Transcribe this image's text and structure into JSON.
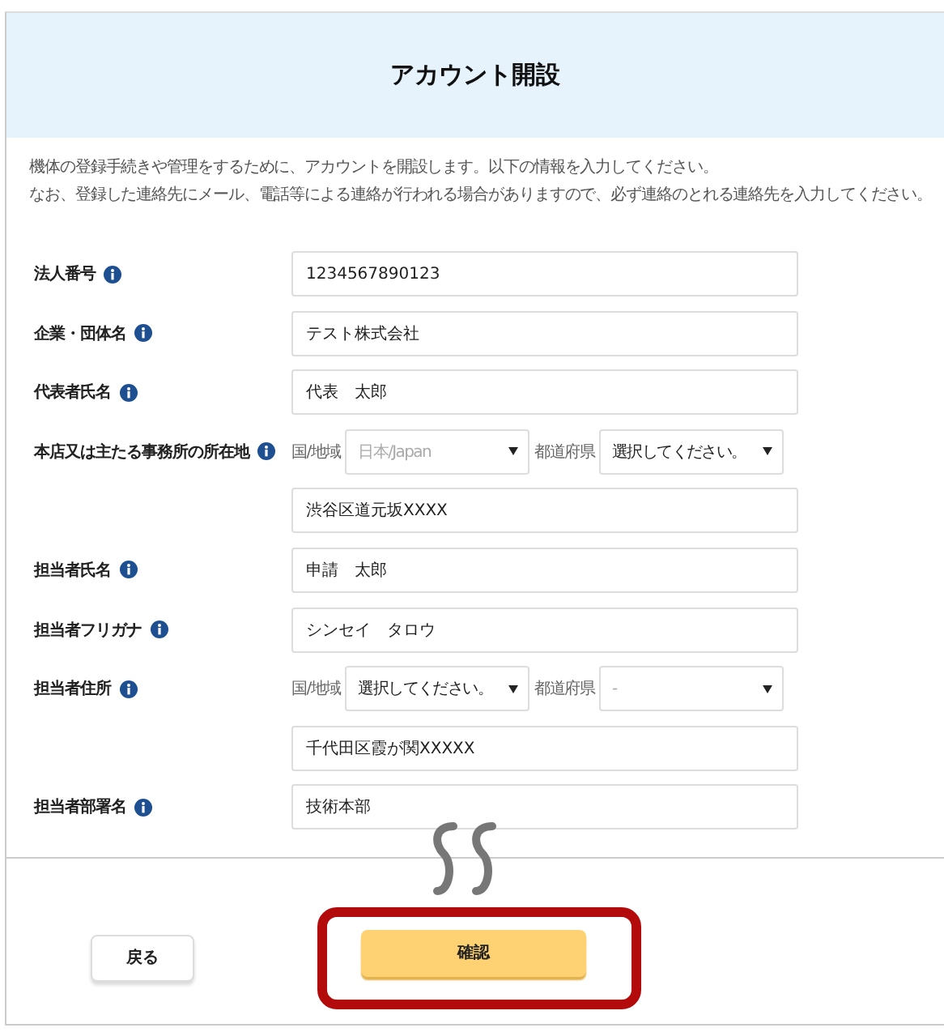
{
  "header": {
    "title": "アカウント開設"
  },
  "intro": [
    "機体の登録手続きや管理をするために、アカウントを開設します。以下の情報を入力してください。",
    "なお、登録した連絡先にメール、電話等による連絡が行われる場合がありますので、必ず連絡のとれる連絡先を入力してください。"
  ],
  "fields": [
    {
      "kind": "text",
      "label": "法人番号",
      "value": "1234567890123"
    },
    {
      "kind": "text",
      "label": "企業・団体名",
      "value": "テスト株式会社"
    },
    {
      "kind": "text",
      "label": "代表者氏名",
      "value": "代表　太郎"
    },
    {
      "kind": "address",
      "label": "本店又は主たる事務所の所在地",
      "country_label": "国/地域",
      "country": {
        "value": "日本/Japan",
        "disabled": true
      },
      "prefecture_label": "都道府県",
      "prefecture": {
        "value": "選択してください。",
        "disabled": false
      },
      "street": "渋谷区道元坂XXXX"
    },
    {
      "kind": "text",
      "label": "担当者氏名",
      "value": "申請　太郎"
    },
    {
      "kind": "text",
      "label": "担当者フリガナ",
      "value": "シンセイ　タロウ"
    },
    {
      "kind": "address",
      "label": "担当者住所",
      "country_label": "国/地域",
      "country": {
        "value": "選択してください。",
        "disabled": false
      },
      "prefecture_label": "都道府県",
      "prefecture": {
        "value": "-",
        "disabled": true
      },
      "street": "千代田区霞が関XXXXX"
    },
    {
      "kind": "text",
      "label": "担当者部署名",
      "value": "技術本部"
    }
  ],
  "buttons": [
    {
      "kind": "secondary",
      "label": "戻る",
      "highlighted": false
    },
    {
      "kind": "primary",
      "label": "確認",
      "highlighted": true
    }
  ]
}
